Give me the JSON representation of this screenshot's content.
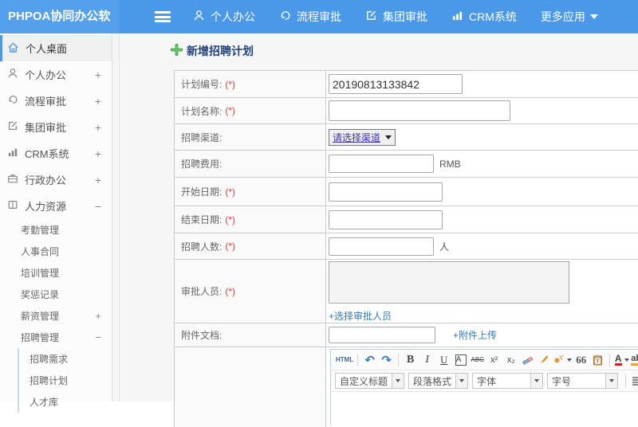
{
  "topbar": {
    "brand": "PHPOA协同办公软件",
    "nav": [
      {
        "label": "个人办公"
      },
      {
        "label": "流程审批"
      },
      {
        "label": "集团审批"
      },
      {
        "label": "CRM系统"
      },
      {
        "label": "更多应用"
      }
    ]
  },
  "sidebar": {
    "items": [
      {
        "label": "个人桌面"
      },
      {
        "label": "个人办公",
        "expand": "+"
      },
      {
        "label": "流程审批",
        "expand": "+"
      },
      {
        "label": "集团审批",
        "expand": "+"
      },
      {
        "label": "CRM系统",
        "expand": "+"
      },
      {
        "label": "行政办公",
        "expand": "+"
      },
      {
        "label": "人力资源",
        "expand": "−"
      },
      {
        "label": "考勤管理"
      },
      {
        "label": "人事合同"
      },
      {
        "label": "培训管理"
      },
      {
        "label": "奖惩记录"
      },
      {
        "label": "薪资管理",
        "expand": "+"
      },
      {
        "label": "招聘管理",
        "expand": "−"
      },
      {
        "label": "招聘需求"
      },
      {
        "label": "招聘计划"
      },
      {
        "label": "人才库"
      }
    ]
  },
  "main": {
    "title": "新增招聘计划",
    "form": {
      "required_mark": "(*)",
      "plan_no": {
        "label": "计划编号:",
        "value": "20190813133842"
      },
      "plan_name": {
        "label": "计划名称:",
        "value": ""
      },
      "channel": {
        "label": "招聘渠道:",
        "selected": "请选择渠道"
      },
      "fee": {
        "label": "招聘费用:",
        "value": "",
        "suffix": "RMB"
      },
      "start_date": {
        "label": "开始日期:",
        "value": ""
      },
      "end_date": {
        "label": "结束日期:",
        "value": ""
      },
      "headcount": {
        "label": "招聘人数:",
        "value": "",
        "suffix": "人"
      },
      "approver": {
        "label": "审批人员:",
        "value": "",
        "link": "+选择审批人员"
      },
      "attachment": {
        "label": "附件文档:",
        "value": "",
        "link": "+附件上传"
      }
    },
    "editor": {
      "source_label": "HTML",
      "undo": "↶",
      "redo": "↷",
      "bold": "B",
      "italic": "I",
      "underline": "U",
      "font_border": "A",
      "strikethrough": "ABC",
      "superscript": "x²",
      "subscript": "x₂",
      "blockquote": "66",
      "forecolor": "A",
      "backcolor": "ab",
      "combos": {
        "custom_title": "自定义标题",
        "paragraph": "段落格式",
        "font_family": "字体",
        "font_size": "字号"
      }
    },
    "colors": {
      "topbar_blue": "#4a99e8",
      "brand_blue": "#55a0ed",
      "title_navy": "#24437c",
      "link_blue": "#2f7ac9",
      "required_red": "#e03a3a",
      "plus_green": "#41ad49"
    }
  }
}
